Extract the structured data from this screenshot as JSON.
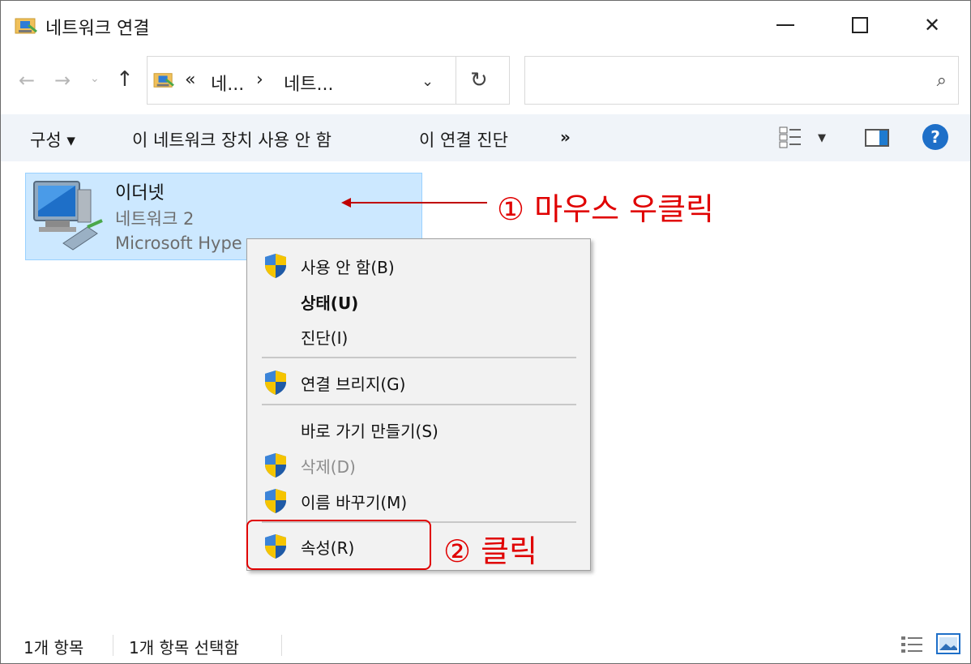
{
  "window": {
    "title": "네트워크 연결",
    "close_glyph": "✕"
  },
  "nav": {
    "back_glyph": "←",
    "forward_glyph": "→",
    "dropdown_glyph": "⌄",
    "up_glyph": "↑",
    "address_prefix": "«",
    "address_segments": [
      "네...",
      "네트..."
    ],
    "address_separator": "›",
    "address_dropdown_glyph": "⌄",
    "refresh_glyph": "↻",
    "search_placeholder": "",
    "search_glyph": "⌕"
  },
  "commandbar": {
    "organize": "구성 ▾",
    "disable": "이 네트워크 장치 사용 안 함",
    "diagnose": "이 연결 진단",
    "more": "»",
    "view_dropdown": "▼",
    "help": "?"
  },
  "item": {
    "name": "이더넷",
    "network": "네트워크 2",
    "adapter": "Microsoft Hype"
  },
  "annotations": {
    "step1": "① 마우스 우클릭",
    "step2": "② 클릭",
    "color": "#e00000"
  },
  "context_menu": {
    "items": [
      {
        "label": "사용 안 함(B)",
        "shield": true
      },
      {
        "label": "상태(U)",
        "bold": true
      },
      {
        "label": "진단(I)"
      },
      {
        "label": "연결 브리지(G)",
        "shield": true
      },
      {
        "label": "바로 가기 만들기(S)"
      },
      {
        "label": "삭제(D)",
        "shield": true,
        "disabled": true
      },
      {
        "label": "이름 바꾸기(M)",
        "shield": true
      },
      {
        "label": "속성(R)",
        "shield": true
      }
    ]
  },
  "statusbar": {
    "item_count": "1개 항목",
    "selected_count": "1개 항목 선택함"
  },
  "colors": {
    "selection_bg": "#cce8ff",
    "selection_border": "#99d1ff",
    "commandbar_bg": "#f0f4f9",
    "accent_blue": "#1e6fc8"
  }
}
